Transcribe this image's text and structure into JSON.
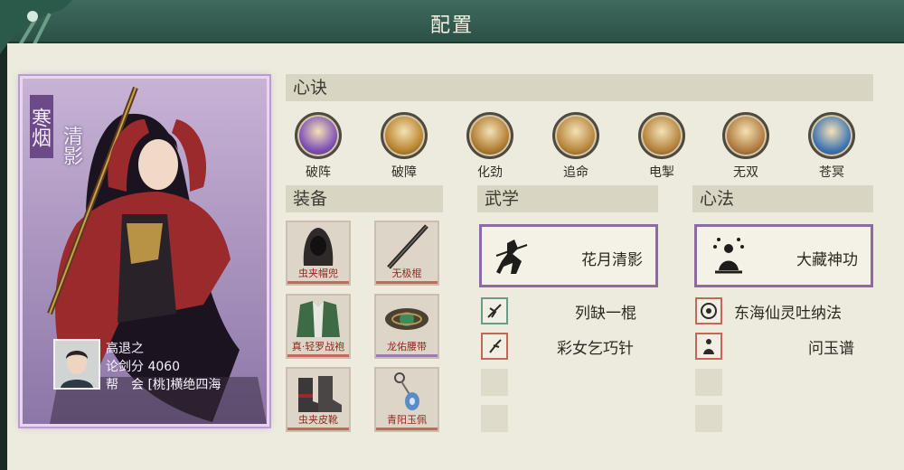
{
  "header": {
    "title": "配置"
  },
  "character": {
    "name_line1": "寒烟",
    "name_line2": "清影",
    "player_name": "高退之",
    "score_label": "论剑分",
    "score_value": "4060",
    "guild_label": "帮　会",
    "guild_value": "[桃]横绝四海"
  },
  "sections": {
    "xinjue": "心诀",
    "equipment": "装备",
    "wuxue": "武学",
    "xinfa": "心法"
  },
  "skills": [
    {
      "label": "破阵",
      "color": "#7d4fb6"
    },
    {
      "label": "破障",
      "color": "#b9832e"
    },
    {
      "label": "化劲",
      "color": "#b07b30"
    },
    {
      "label": "追命",
      "color": "#b7853a"
    },
    {
      "label": "电掣",
      "color": "#b4813a"
    },
    {
      "label": "无双",
      "color": "#b07a3e"
    },
    {
      "label": "苍冥",
      "color": "#3e74b2"
    }
  ],
  "equipment": [
    {
      "label": "虫夹帽兜",
      "icon": "hood-icon"
    },
    {
      "label": "无极棍",
      "icon": "staff-icon"
    },
    {
      "label": "真·轻罗战袍",
      "icon": "robe-icon"
    },
    {
      "label": "龙佑腰带",
      "icon": "belt-icon"
    },
    {
      "label": "虫夹皮靴",
      "icon": "boots-icon"
    },
    {
      "label": "青阳玉佩",
      "icon": "pendant-icon"
    }
  ],
  "wuxue": {
    "main": "花月清影",
    "items": [
      "列缺一棍",
      "彩女乞巧针"
    ]
  },
  "xinfa": {
    "main": "大藏神功",
    "items": [
      "东海仙灵吐纳法",
      "问玉谱"
    ]
  }
}
